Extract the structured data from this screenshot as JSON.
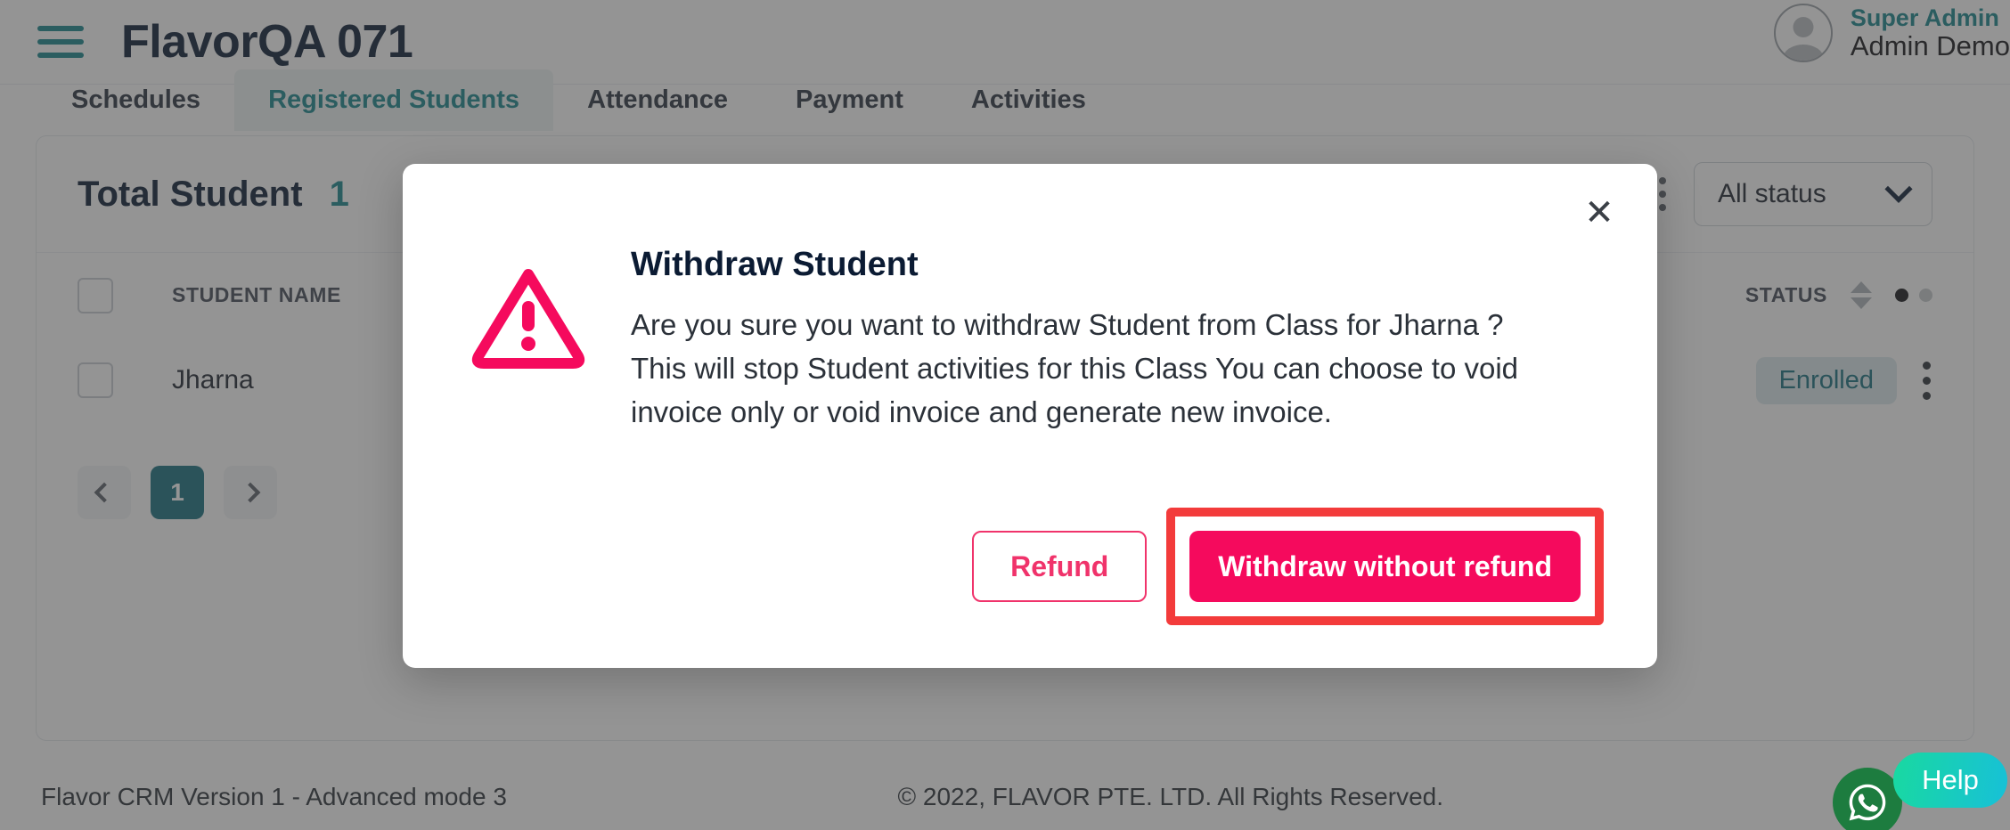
{
  "header": {
    "menu_icon": "hamburger-icon",
    "title": "FlavorQA 071",
    "user": {
      "role": "Super Admin",
      "name": "Admin Demo",
      "avatar_icon": "user-avatar-icon"
    }
  },
  "tabs": [
    {
      "label": "Schedules",
      "active": false
    },
    {
      "label": "Registered Students",
      "active": true
    },
    {
      "label": "Attendance",
      "active": false
    },
    {
      "label": "Payment",
      "active": false
    },
    {
      "label": "Activities",
      "active": false
    }
  ],
  "toolbar": {
    "total_label": "Total Student",
    "total_value": "1",
    "kebab_icon": "more-vertical-icon",
    "status_filter": {
      "value": "All status",
      "chevron_icon": "chevron-down-icon"
    }
  },
  "table": {
    "columns": [
      "STUDENT NAME",
      "STATUS"
    ],
    "sort_icon": "sort-arrows-icon",
    "pager_dots_icon": "page-dots-icon",
    "rows": [
      {
        "checkbox": "row-checkbox",
        "name": "Jharna",
        "status": "Enrolled",
        "menu_icon": "more-vertical-icon"
      }
    ]
  },
  "pagination": {
    "prev_icon": "chevron-left-icon",
    "pages": [
      "1"
    ],
    "current": "1",
    "next_icon": "chevron-right-icon"
  },
  "footer": {
    "version": "Flavor CRM Version 1 - Advanced mode 3",
    "copyright": "© 2022, FLAVOR PTE. LTD. All Rights Reserved."
  },
  "widgets": {
    "whatsapp_icon": "whatsapp-icon",
    "help_label": "Help"
  },
  "modal": {
    "close_icon": "close-icon",
    "warning_icon": "warning-triangle-icon",
    "title": "Withdraw Student",
    "message": "Are you sure you want to withdraw Student from Class for Jharna ? This will stop Student activities for this Class You can choose to void invoice only or void invoice and generate new invoice.",
    "buttons": {
      "secondary": "Refund",
      "primary": "Withdraw without refund"
    }
  },
  "colors": {
    "teal": "#18868c",
    "navy": "#0b1b33",
    "pink": "#f50a5d",
    "highlight_red": "#f33b3b",
    "badge_bg": "#dbe9ed",
    "badge_text": "#17707f"
  }
}
